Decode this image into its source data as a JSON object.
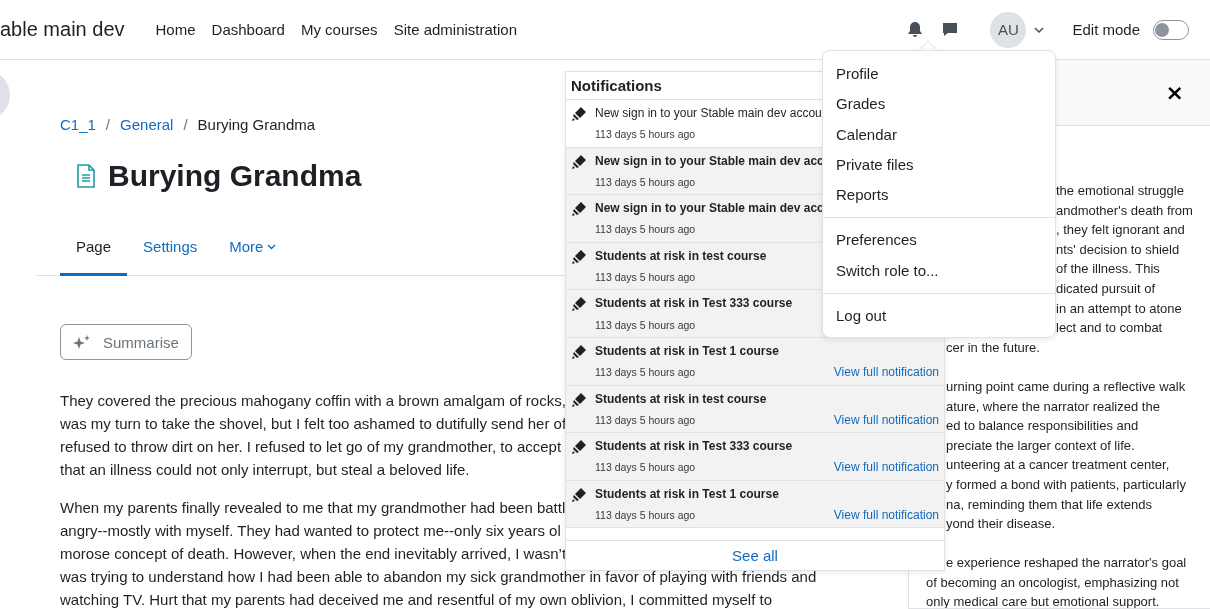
{
  "site_name": "able main dev",
  "nav": [
    {
      "label": "Home"
    },
    {
      "label": "Dashboard"
    },
    {
      "label": "My courses"
    },
    {
      "label": "Site administration"
    }
  ],
  "user": {
    "initials": "AU"
  },
  "edit_mode": {
    "label": "Edit mode",
    "on": false
  },
  "breadcrumb": [
    {
      "label": "C1_1",
      "link": true
    },
    {
      "label": "/",
      "kind": "separator"
    },
    {
      "label": "General",
      "link": true
    },
    {
      "label": "/",
      "kind": "separator"
    },
    {
      "label": "Burying Grandma",
      "link": false
    }
  ],
  "title": "Burying Grandma",
  "tabs": [
    {
      "label": "Page",
      "selected": true,
      "dropdown": false
    },
    {
      "label": "Settings",
      "selected": false,
      "dropdown": false
    },
    {
      "label": "More",
      "selected": false,
      "dropdown": true
    }
  ],
  "summarise_button": "Summarise",
  "content": [
    [
      "They covered the precious mahogany coffin with a brown amalgam of rocks,",
      "was my turn to take the shovel, but I felt too ashamed to dutifully send her of",
      "refused to throw dirt on her. I refused to let go of my grandmother, to accept",
      "that an illness could not only interrupt, but steal a beloved life."
    ],
    [
      "When my parents finally revealed to me that my grandmother had been battl",
      "angry--mostly with myself. They had wanted to protect me--only six years ol",
      "morose concept of death. However, when the end inevitably arrived, I wasn’t",
      "was trying to understand how I had been able to abandon my sick grandmother in favor of playing with friends and",
      "watching TV. Hurt that my parents had deceived me and resentful of my own oblivion, I committed myself to"
    ]
  ],
  "notifications": {
    "title": "Notifications",
    "items": [
      {
        "text": "New sign in to your Stable main dev accou",
        "time": "113 days 5 hours ago",
        "read": true
      },
      {
        "text": "New sign in to your Stable main dev acc",
        "time": "113 days 5 hours ago",
        "read": false
      },
      {
        "text": "New sign in to your Stable main dev acc",
        "time": "113 days 5 hours ago",
        "read": false
      },
      {
        "text": "Students at risk in test course",
        "time": "113 days 5 hours ago",
        "read": false
      },
      {
        "text": "Students at risk in Test 333 course",
        "time": "113 days 5 hours ago",
        "read": false
      },
      {
        "text": "Students at risk in Test 1 course",
        "time": "113 days 5 hours ago",
        "read": false,
        "link": "View full notification"
      },
      {
        "text": "Students at risk in test course",
        "time": "113 days 5 hours ago",
        "read": false,
        "link": "View full notification"
      },
      {
        "text": "Students at risk in Test 333 course",
        "time": "113 days 5 hours ago",
        "read": false,
        "link": "View full notification"
      },
      {
        "text": "Students at risk in Test 1 course",
        "time": "113 days 5 hours ago",
        "read": false,
        "link": "View full notification"
      }
    ],
    "see_all": "See all"
  },
  "user_menu": [
    [
      "Profile",
      "Grades",
      "Calendar",
      "Private files",
      "Reports"
    ],
    [
      "Preferences",
      "Switch role to..."
    ],
    [
      "Log out"
    ]
  ],
  "drawer": {
    "close": "×",
    "paragraphs": [
      [
        {
          "kind": "beside_menu",
          "lines": [
            "the emotional struggle",
            "andmother's death from",
            ", they felt ignorant and",
            "nts' decision to shield",
            "of the illness. This",
            "dicated pursuit of",
            "in an attempt to atone",
            "lect and to combat"
          ]
        },
        {
          "kind": "beside_popover",
          "lines": [
            "cer in the future."
          ]
        }
      ],
      [
        {
          "kind": "beside_popover",
          "lines": [
            "urning point came during a reflective walk",
            "ature, where the narrator realized the",
            "ed to balance responsibilities and",
            "preciate the larger context of life.",
            "unteering at a cancer treatment center,",
            "y formed a bond with patients, particularly",
            "na, reminding them that life extends",
            "yond their disease."
          ]
        }
      ],
      [
        {
          "kind": "beside_popover",
          "lines": [
            "e experience reshaped the narrator's goal"
          ]
        },
        {
          "kind": "full",
          "lines": [
            "of becoming an oncologist, emphasizing not",
            "only medical care but emotional support."
          ]
        }
      ]
    ]
  }
}
